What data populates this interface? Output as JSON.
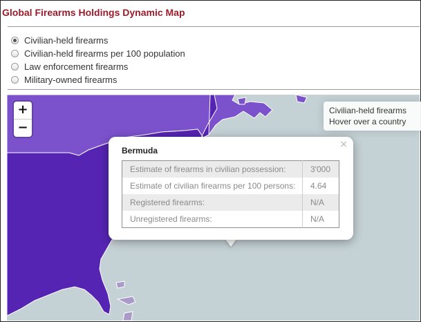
{
  "app": {
    "title": "Global Firearms Holdings Dynamic Map"
  },
  "radios": [
    {
      "label": "Civilian-held firearms",
      "checked": true
    },
    {
      "label": "Civilian-held firearms per 100 population",
      "checked": false
    },
    {
      "label": "Law enforcement firearms",
      "checked": false
    },
    {
      "label": "Military-owned firearms",
      "checked": false
    }
  ],
  "zoom": {
    "in_label": "+",
    "out_label": "−"
  },
  "info": {
    "layer": "Civilian-held firearms",
    "hint": "Hover over a country"
  },
  "popup": {
    "close_label": "×",
    "country": "Bermuda",
    "rows": [
      {
        "label": "Estimate of firearms in civilian possession:",
        "value": "3'000"
      },
      {
        "label": "Estimate of civilian firearms per 100 persons:",
        "value": "4.64"
      },
      {
        "label": "Registered firearms:",
        "value": "N/A"
      },
      {
        "label": "Unregistered firearms:",
        "value": "N/A"
      }
    ]
  },
  "colors": {
    "title": "#9c1b2a",
    "ocean": "#c4d1d5",
    "usa": "#5524b2",
    "canada": "#7b52cc",
    "caribbean": "#a99ac9"
  }
}
